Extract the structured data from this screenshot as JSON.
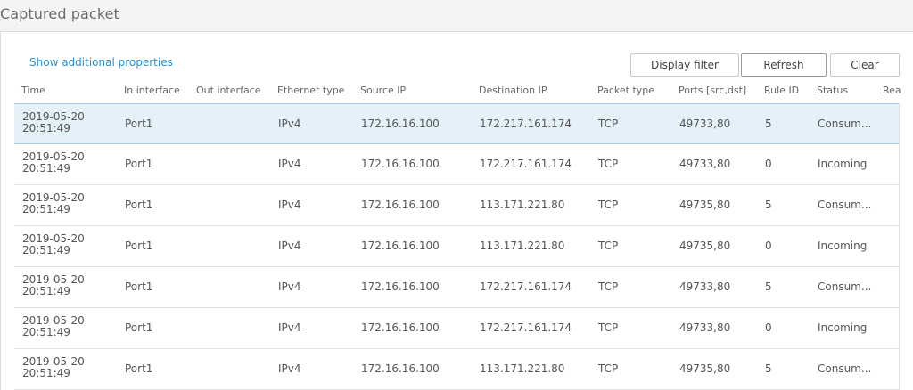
{
  "page": {
    "title": "Captured packet"
  },
  "actions": {
    "more_link": "Show additional properties",
    "display_filter": "Display filter",
    "refresh": "Refresh",
    "clear": "Clear"
  },
  "columns": [
    "Time",
    "In interface",
    "Out interface",
    "Ethernet type",
    "Source IP",
    "Destination IP",
    "Packet type",
    "Ports [src,dst]",
    "Rule ID",
    "Status",
    "Rea"
  ],
  "rows": [
    {
      "date": "2019-05-20",
      "time": "20:51:49",
      "in_if": "Port1",
      "out_if": "",
      "eth": "IPv4",
      "src": "172.16.16.100",
      "dst": "172.217.161.174",
      "ptype": "TCP",
      "ports": "49733,80",
      "rule": "5",
      "status": "Consum..."
    },
    {
      "date": "2019-05-20",
      "time": "20:51:49",
      "in_if": "Port1",
      "out_if": "",
      "eth": "IPv4",
      "src": "172.16.16.100",
      "dst": "172.217.161.174",
      "ptype": "TCP",
      "ports": "49733,80",
      "rule": "0",
      "status": "Incoming"
    },
    {
      "date": "2019-05-20",
      "time": "20:51:49",
      "in_if": "Port1",
      "out_if": "",
      "eth": "IPv4",
      "src": "172.16.16.100",
      "dst": "113.171.221.80",
      "ptype": "TCP",
      "ports": "49735,80",
      "rule": "5",
      "status": "Consum..."
    },
    {
      "date": "2019-05-20",
      "time": "20:51:49",
      "in_if": "Port1",
      "out_if": "",
      "eth": "IPv4",
      "src": "172.16.16.100",
      "dst": "113.171.221.80",
      "ptype": "TCP",
      "ports": "49735,80",
      "rule": "0",
      "status": "Incoming"
    },
    {
      "date": "2019-05-20",
      "time": "20:51:49",
      "in_if": "Port1",
      "out_if": "",
      "eth": "IPv4",
      "src": "172.16.16.100",
      "dst": "172.217.161.174",
      "ptype": "TCP",
      "ports": "49733,80",
      "rule": "5",
      "status": "Consum..."
    },
    {
      "date": "2019-05-20",
      "time": "20:51:49",
      "in_if": "Port1",
      "out_if": "",
      "eth": "IPv4",
      "src": "172.16.16.100",
      "dst": "172.217.161.174",
      "ptype": "TCP",
      "ports": "49733,80",
      "rule": "0",
      "status": "Incoming"
    },
    {
      "date": "2019-05-20",
      "time": "20:51:49",
      "in_if": "Port1",
      "out_if": "",
      "eth": "IPv4",
      "src": "172.16.16.100",
      "dst": "113.171.221.80",
      "ptype": "TCP",
      "ports": "49735,80",
      "rule": "5",
      "status": "Consum..."
    }
  ],
  "selected_row": 0
}
